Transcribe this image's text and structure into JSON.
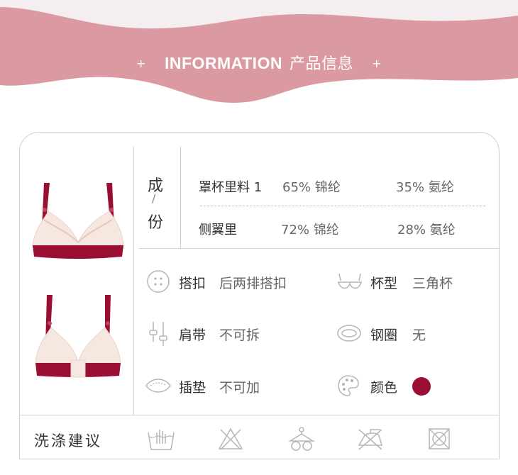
{
  "header": {
    "title_en": "INFORMATION",
    "title_cn": "产品信息",
    "plus": "+"
  },
  "composition": {
    "label_top": "成",
    "label_slash": "/",
    "label_bottom": "份",
    "rows": [
      {
        "name": "罩杯里料 1",
        "v1": "65% 锦纶",
        "v2": "35% 氨纶"
      },
      {
        "name": "侧翼里",
        "v1": "72% 锦纶",
        "v2": "28% 氨纶"
      }
    ]
  },
  "attributes": [
    {
      "label": "搭扣",
      "value": "后两排搭扣",
      "icon": "button-icon"
    },
    {
      "label": "杯型",
      "value": "三角杯",
      "icon": "cup-shape-icon"
    },
    {
      "label": "肩带",
      "value": "不可拆",
      "icon": "strap-icon"
    },
    {
      "label": "钢圈",
      "value": "无",
      "icon": "underwire-icon"
    },
    {
      "label": "插垫",
      "value": "不可加",
      "icon": "pad-icon"
    },
    {
      "label": "颜色",
      "value": "",
      "icon": "palette-icon"
    }
  ],
  "care": {
    "label": "洗涤建议",
    "icons": [
      "hand-wash-icon",
      "no-bleach-icon",
      "hang-dry-icon",
      "no-iron-icon",
      "no-tumble-dry-icon"
    ]
  },
  "colors": {
    "banner": "#db9aa2",
    "banner_light": "#f5eef0",
    "product": "#9b0e34",
    "lace": "#f6e7e1",
    "line": "#cfcfcf",
    "icon": "#b5b5b5"
  }
}
